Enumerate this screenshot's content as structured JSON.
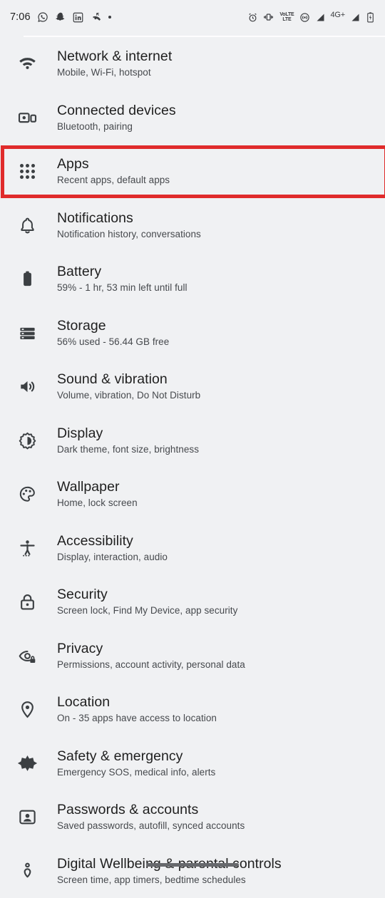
{
  "status_bar": {
    "time": "7:06",
    "left_icons": [
      {
        "name": "whatsapp-icon",
        "label": "WhatsApp"
      },
      {
        "name": "snapchat-icon",
        "label": "Snapchat"
      },
      {
        "name": "linkedin-icon",
        "label": "LinkedIn"
      },
      {
        "name": "missed-call-icon",
        "label": "Missed call"
      },
      {
        "name": "more-notifications-dot",
        "label": "More notifications"
      }
    ],
    "right_icons": [
      {
        "name": "alarm-icon",
        "label": "Alarm set"
      },
      {
        "name": "vibrate-icon",
        "label": "Vibrate mode"
      },
      {
        "name": "volte-icon",
        "label": "VoLTE",
        "line1": "VoLTE",
        "line2": "LTE"
      },
      {
        "name": "hotspot-icon",
        "label": "Hotspot"
      },
      {
        "name": "signal-sim1-icon",
        "label": "Signal SIM 1"
      },
      {
        "name": "network-type-label",
        "label": "4G+"
      },
      {
        "name": "signal-sim2-icon",
        "label": "Signal SIM 2"
      },
      {
        "name": "battery-icon",
        "label": "Battery charging"
      }
    ],
    "network_type": "4G+",
    "volte_line1": "VoLTE",
    "volte_line2": "LTE"
  },
  "theme": {
    "background": "#f0f1f3",
    "title_color": "#1f1f1f",
    "subtitle_color": "#46494d",
    "icon_color": "#3c4043",
    "highlight_color": "#e02b2b",
    "gesture_bar_color": "#67696d"
  },
  "settings": {
    "rows": [
      {
        "icon": "wifi-icon",
        "title": "Network & internet",
        "subtitle": "Mobile, Wi-Fi, hotspot",
        "highlighted": false
      },
      {
        "icon": "connected-devices-icon",
        "title": "Connected devices",
        "subtitle": "Bluetooth, pairing",
        "highlighted": false
      },
      {
        "icon": "apps-grid-icon",
        "title": "Apps",
        "subtitle": "Recent apps, default apps",
        "highlighted": true
      },
      {
        "icon": "bell-icon",
        "title": "Notifications",
        "subtitle": "Notification history, conversations",
        "highlighted": false
      },
      {
        "icon": "battery-icon",
        "title": "Battery",
        "subtitle": "59% - 1 hr, 53 min left until full",
        "highlighted": false
      },
      {
        "icon": "storage-icon",
        "title": "Storage",
        "subtitle": "56% used - 56.44 GB free",
        "highlighted": false
      },
      {
        "icon": "volume-icon",
        "title": "Sound & vibration",
        "subtitle": "Volume, vibration, Do Not Disturb",
        "highlighted": false
      },
      {
        "icon": "brightness-icon",
        "title": "Display",
        "subtitle": "Dark theme, font size, brightness",
        "highlighted": false
      },
      {
        "icon": "palette-icon",
        "title": "Wallpaper",
        "subtitle": "Home, lock screen",
        "highlighted": false
      },
      {
        "icon": "accessibility-icon",
        "title": "Accessibility",
        "subtitle": "Display, interaction, audio",
        "highlighted": false
      },
      {
        "icon": "lock-icon",
        "title": "Security",
        "subtitle": "Screen lock, Find My Device, app security",
        "highlighted": false
      },
      {
        "icon": "privacy-eye-icon",
        "title": "Privacy",
        "subtitle": "Permissions, account activity, personal data",
        "highlighted": false
      },
      {
        "icon": "location-pin-icon",
        "title": "Location",
        "subtitle": "On - 35 apps have access to location",
        "highlighted": false
      },
      {
        "icon": "emergency-star-icon",
        "title": "Safety & emergency",
        "subtitle": "Emergency SOS, medical info, alerts",
        "highlighted": false
      },
      {
        "icon": "account-card-icon",
        "title": "Passwords & accounts",
        "subtitle": "Saved passwords, autofill, synced accounts",
        "highlighted": false
      },
      {
        "icon": "wellbeing-icon",
        "title": "Digital Wellbeing & parental controls",
        "subtitle": "Screen time, app timers, bedtime schedules",
        "highlighted": false
      }
    ]
  }
}
